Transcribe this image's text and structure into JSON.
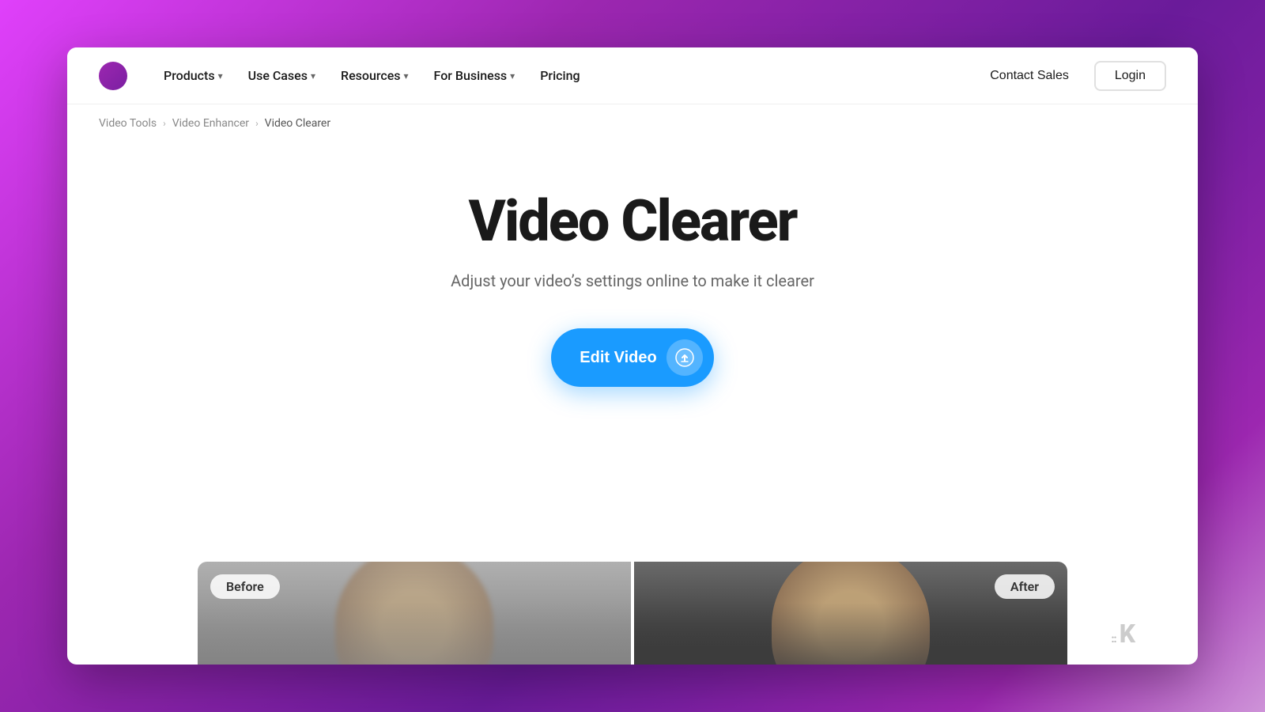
{
  "background": {
    "gradient_start": "#e040fb",
    "gradient_end": "#7b1fa2"
  },
  "navbar": {
    "logo_alt": "Kapwing logo",
    "nav_items": [
      {
        "label": "Products",
        "has_dropdown": true
      },
      {
        "label": "Use Cases",
        "has_dropdown": true
      },
      {
        "label": "Resources",
        "has_dropdown": true
      },
      {
        "label": "For Business",
        "has_dropdown": true
      },
      {
        "label": "Pricing",
        "has_dropdown": false
      }
    ],
    "contact_sales_label": "Contact Sales",
    "login_label": "Login"
  },
  "breadcrumb": {
    "items": [
      {
        "label": "Video Tools",
        "href": "#"
      },
      {
        "label": "Video Enhancer",
        "href": "#"
      },
      {
        "label": "Video Clearer",
        "href": "#",
        "current": true
      }
    ]
  },
  "hero": {
    "title": "Video Clearer",
    "subtitle": "Adjust your video’s settings online to make it clearer",
    "cta_label": "Edit Video",
    "upload_icon": "upload-icon"
  },
  "before_after": {
    "before_label": "Before",
    "after_label": "After"
  },
  "watermark": {
    "brand": "K",
    "dots": "::"
  }
}
